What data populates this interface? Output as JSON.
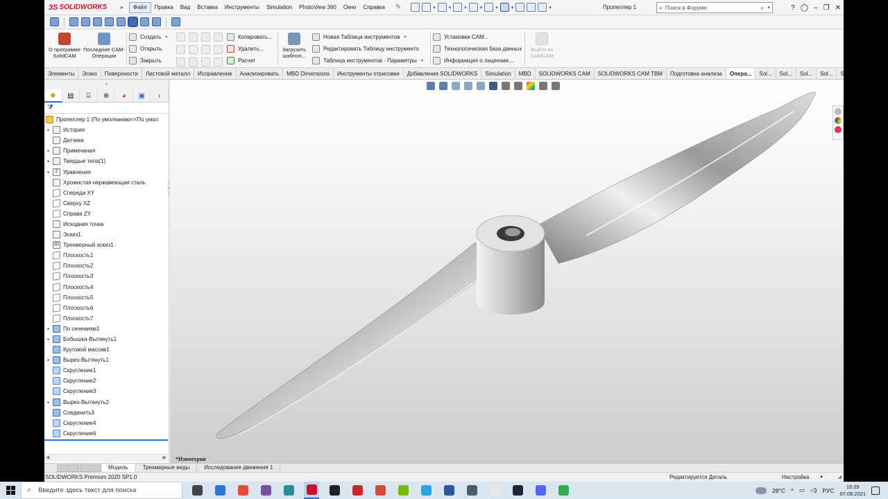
{
  "app": {
    "logo_text": "SOLIDWORKS",
    "logo_mark": "3S",
    "document_title": "Пропеллер 1",
    "menu": [
      "Файл",
      "Правка",
      "Вид",
      "Вставка",
      "Инструменты",
      "Simulation",
      "PhotoView 360",
      "Окно",
      "Справка"
    ],
    "search_placeholder": "Поиск в Форуме"
  },
  "ribbon": {
    "about_label": "О программе SolidCAM",
    "recent_label": "Последние CAM-Операции",
    "file_ops": [
      "Создать",
      "Открыть",
      "Закрыть"
    ],
    "edit_ops": [
      "Копировать...",
      "Удалить...",
      "Расчет"
    ],
    "load_template_label": "Загрузить шаблон...",
    "tool_table_ops": [
      "Новая Таблица инструментов",
      "Редактировать Таблицу инструменто",
      "Таблица инструментов - Параметры"
    ],
    "settings_ops": [
      "Установки CAM...",
      "Технологическая база данных",
      "Информация о лицензии..."
    ],
    "exit_label": "Выйти из SolidCAM"
  },
  "tabs": [
    "Элементы",
    "Эскиз",
    "Поверхности",
    "Листовой металл",
    "Исправление",
    "Анализировать",
    "MBD Dimensions",
    "Инструменты отрисовки",
    "Добавления SOLIDWORKS",
    "Simulation",
    "MBD",
    "SOLIDWORKS CAM",
    "SOLIDWORKS CAM TBM",
    "Подготовка анализа",
    "Опера...",
    "Sol...",
    "Sol...",
    "Sol...",
    "Sol...",
    "Sol...",
    "Sol..."
  ],
  "active_tab_index": 14,
  "tree": {
    "root": "Пропеллер 1  (По умолчанию<<По умол",
    "items": [
      {
        "label": "История",
        "icon": "history-icon",
        "expand": true
      },
      {
        "label": "Датчики",
        "icon": "sensor-icon",
        "expand": false
      },
      {
        "label": "Примечания",
        "icon": "annotation-icon",
        "expand": true
      },
      {
        "label": "Твердые тела(1)",
        "icon": "solid-bodies-icon",
        "expand": true
      },
      {
        "label": "Уравнения",
        "icon": "equations-icon",
        "expand": true
      },
      {
        "label": "Хромистая нержавеющая сталь",
        "icon": "material-icon",
        "expand": false
      },
      {
        "label": "Спереди XY",
        "icon": "plane-icon",
        "expand": false
      },
      {
        "label": "Сверху XZ",
        "icon": "plane-icon",
        "expand": false
      },
      {
        "label": "Справа ZY",
        "icon": "plane-icon",
        "expand": false
      },
      {
        "label": "Исходная точка",
        "icon": "origin-icon",
        "expand": false
      },
      {
        "label": "Эскиз1",
        "icon": "sketch-icon",
        "expand": false
      },
      {
        "label": "Трехмерный эскиз1",
        "icon": "sketch3d-icon",
        "expand": false
      },
      {
        "label": "Плоскость1",
        "icon": "plane-icon",
        "expand": false
      },
      {
        "label": "Плоскость2",
        "icon": "plane-icon",
        "expand": false
      },
      {
        "label": "Плоскость3",
        "icon": "plane-icon",
        "expand": false
      },
      {
        "label": "Плоскость4",
        "icon": "plane-icon",
        "expand": false
      },
      {
        "label": "Плоскость5",
        "icon": "plane-icon",
        "expand": false
      },
      {
        "label": "Плоскость6",
        "icon": "plane-icon",
        "expand": false
      },
      {
        "label": "Плоскость7",
        "icon": "plane-icon",
        "expand": false
      },
      {
        "label": "По сечениям1",
        "icon": "loft-icon",
        "expand": true
      },
      {
        "label": "Бобышка-Вытянуть1",
        "icon": "extrude-icon",
        "expand": true
      },
      {
        "label": "Круговой массив1",
        "icon": "pattern-icon",
        "expand": false
      },
      {
        "label": "Вырез-Вытянуть1",
        "icon": "cut-extrude-icon",
        "expand": true
      },
      {
        "label": "Скругление1",
        "icon": "fillet-icon",
        "expand": false
      },
      {
        "label": "Скругление2",
        "icon": "fillet-icon",
        "expand": false
      },
      {
        "label": "Скругление3",
        "icon": "fillet-icon",
        "expand": false
      },
      {
        "label": "Вырез-Вытянуть2",
        "icon": "cut-extrude-icon",
        "expand": true
      },
      {
        "label": "Соединить3",
        "icon": "combine-icon",
        "expand": false
      },
      {
        "label": "Скругление4",
        "icon": "fillet-icon",
        "expand": false
      },
      {
        "label": "Скругление6",
        "icon": "fillet-icon",
        "expand": false
      }
    ]
  },
  "viewport": {
    "view_label": "*Изометрия"
  },
  "model_tabs": [
    "Модель",
    "Трехмерные виды",
    "Исследование движения 1"
  ],
  "status": {
    "product": "SOLIDWORKS Premium 2020 SP1.0",
    "state": "Редактируется Деталь",
    "custom": "Настройка"
  },
  "taskbar": {
    "search_placeholder": "Введите здесь текст для поиска",
    "temperature": "28°C",
    "lang": "РУС",
    "time": "15:29",
    "date": "07.09.2021",
    "apps": [
      {
        "name": "task-view-icon",
        "color": "#444444"
      },
      {
        "name": "mail-icon",
        "color": "#2b78d0"
      },
      {
        "name": "chrome-icon",
        "color": "#e24c3c"
      },
      {
        "name": "viber-icon",
        "color": "#7b519d"
      },
      {
        "name": "ps-icon",
        "color": "#2e8b99"
      },
      {
        "name": "solidworks-icon",
        "color": "#c8102e"
      },
      {
        "name": "app-dark-icon",
        "color": "#222222"
      },
      {
        "name": "nx-icon",
        "color": "#c62828"
      },
      {
        "name": "app-red-icon",
        "color": "#d84a3a"
      },
      {
        "name": "nvidia-icon",
        "color": "#76b900"
      },
      {
        "name": "telegram-icon",
        "color": "#2aa3e0"
      },
      {
        "name": "word-icon",
        "color": "#2b579a"
      },
      {
        "name": "files-icon",
        "color": "#4a5a70"
      },
      {
        "name": "document-icon",
        "color": "#e8e8e8"
      },
      {
        "name": "steam-icon",
        "color": "#1b2838"
      },
      {
        "name": "discord-icon",
        "color": "#5865f2"
      },
      {
        "name": "drive-icon",
        "color": "#34a853"
      }
    ]
  }
}
